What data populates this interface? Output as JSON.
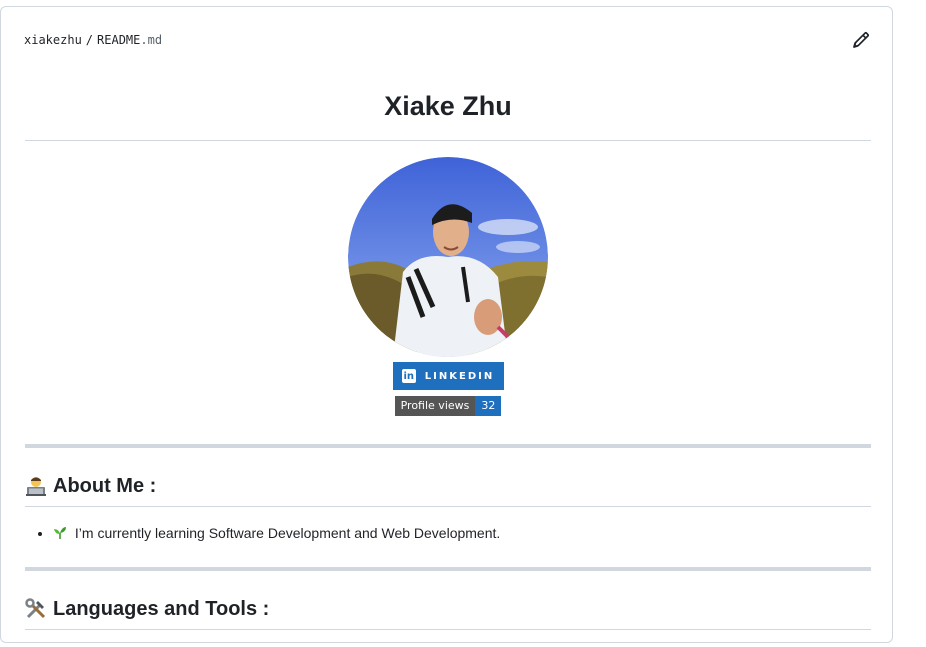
{
  "header": {
    "owner": "xiakezhu",
    "separator": "/",
    "file_name": "README",
    "file_ext": ".md"
  },
  "readme": {
    "title": "Xiake Zhu",
    "badges": {
      "linkedin_label": "LINKEDIN",
      "linkedin_icon": "in",
      "views_label": "Profile views",
      "views_count": "32"
    },
    "about": {
      "heading": "About Me :",
      "icon": "technologist-emoji",
      "items": [
        {
          "icon": "seedling-emoji",
          "text": "I’m currently learning Software Development and Web Development."
        }
      ]
    },
    "languages": {
      "heading": "Languages and Tools :",
      "icon": "hammer-wrench-emoji"
    }
  },
  "colors": {
    "linkedin_blue": "#1f6fbf",
    "badge_gray": "#555555",
    "border": "#d0d7de"
  }
}
